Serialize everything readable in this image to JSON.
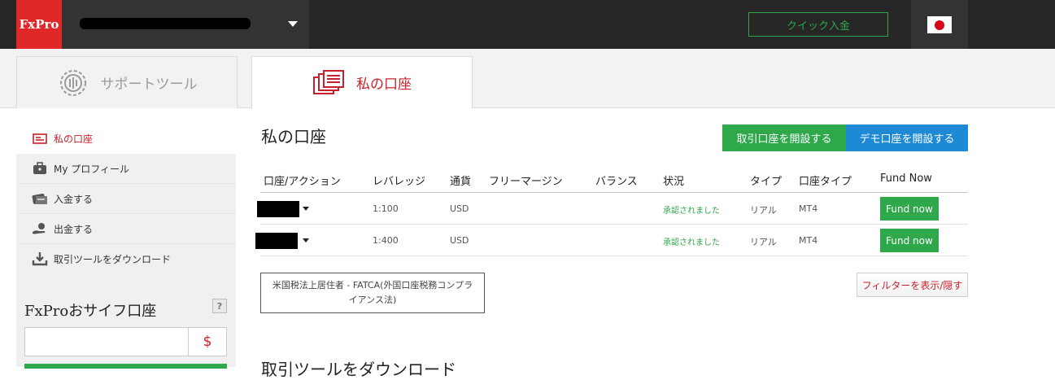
{
  "topbar": {
    "logo": "FxPro",
    "quick_deposit": "クイック入金"
  },
  "tabs": [
    {
      "label": "サポートツール",
      "icon": "gear-chart-icon"
    },
    {
      "label": "私の口座",
      "icon": "documents-icon"
    }
  ],
  "sidebar": {
    "items": [
      {
        "label": "私の口座",
        "icon": "card-icon",
        "active": true
      },
      {
        "label": "My プロフィール",
        "icon": "briefcase-icon"
      },
      {
        "label": "入金する",
        "icon": "wallet-in-icon"
      },
      {
        "label": "出金する",
        "icon": "hand-coin-icon"
      },
      {
        "label": "取引ツールをダウンロード",
        "icon": "download-icon"
      }
    ],
    "wallet": {
      "title": "FxProおサイフ口座",
      "help": "?",
      "currency": "$"
    }
  },
  "main": {
    "title": "私の口座",
    "open_real": "取引口座を開設する",
    "open_demo": "デモ口座を開設する",
    "table": {
      "headers": [
        "口座/アクション",
        "レバレッジ",
        "通貨",
        "フリーマージン",
        "バランス",
        "状況",
        "タイプ",
        "口座タイプ",
        "Fund Now"
      ],
      "rows": [
        {
          "leverage": "1:100",
          "currency": "USD",
          "status": "承認されました",
          "type": "リアル",
          "account_type": "MT4",
          "action": "Fund now"
        },
        {
          "leverage": "1:400",
          "currency": "USD",
          "status": "承認されました",
          "type": "リアル",
          "account_type": "MT4",
          "action": "Fund now"
        }
      ]
    },
    "fatca": "米国税法上居住者 - FATCA(外国口座税務コンプライアンス法)",
    "filter": "フィルターを表示/隠す",
    "next_heading": "取引ツールをダウンロード"
  },
  "colors": {
    "brand_red": "#e02828",
    "green": "#2ea84a",
    "blue": "#1e8ad6",
    "topbar": "#262626"
  }
}
